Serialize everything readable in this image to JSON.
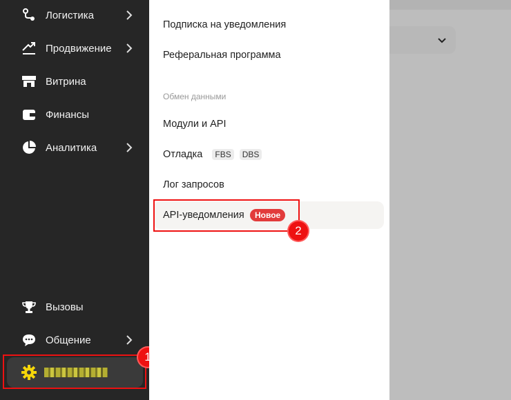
{
  "sidebar": {
    "items": [
      {
        "label": "Логистика",
        "icon": "route-icon",
        "has_submenu": true
      },
      {
        "label": "Продвижение",
        "icon": "trend-up-icon",
        "has_submenu": true
      },
      {
        "label": "Витрина",
        "icon": "storefront-icon",
        "has_submenu": false
      },
      {
        "label": "Финансы",
        "icon": "wallet-icon",
        "has_submenu": false
      },
      {
        "label": "Аналитика",
        "icon": "pie-chart-icon",
        "has_submenu": true
      },
      {
        "label": "Вызовы",
        "icon": "trophy-icon",
        "has_submenu": false
      },
      {
        "label": "Общение",
        "icon": "chat-icon",
        "has_submenu": true
      }
    ],
    "settings": {
      "icon": "gear-icon",
      "accent": "#f5d60a"
    }
  },
  "submenu": {
    "links_top": [
      "Подписка на уведомления",
      "Реферальная программа"
    ],
    "section_title": "Обмен данными",
    "modules": "Модули и API",
    "debug": {
      "label": "Отладка",
      "tags": [
        "FBS",
        "DBS"
      ]
    },
    "log": "Лог запросов",
    "api_notifications": {
      "label": "API-уведомления",
      "badge": "Новое"
    }
  },
  "annotations": {
    "step1": "1",
    "step2": "2",
    "color": "#e11111"
  }
}
